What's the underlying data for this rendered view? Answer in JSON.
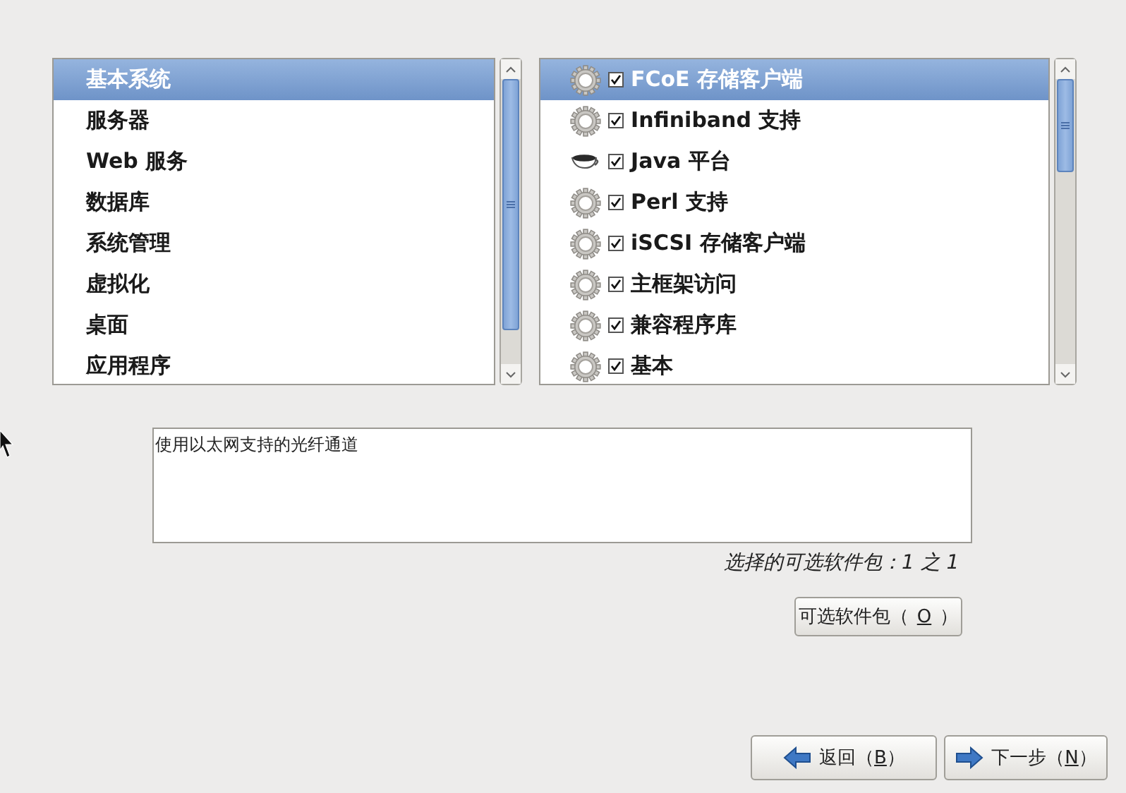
{
  "groups": {
    "items": [
      {
        "label": "基本系统",
        "selected": true
      },
      {
        "label": "服务器",
        "selected": false
      },
      {
        "label": "Web 服务",
        "selected": false
      },
      {
        "label": "数据库",
        "selected": false
      },
      {
        "label": "系统管理",
        "selected": false
      },
      {
        "label": "虚拟化",
        "selected": false
      },
      {
        "label": "桌面",
        "selected": false
      },
      {
        "label": "应用程序",
        "selected": false
      }
    ]
  },
  "packages": {
    "items": [
      {
        "label": "FCoE 存储客户端",
        "kind": "gear",
        "checked": true,
        "selected": true
      },
      {
        "label": "Infiniband 支持",
        "kind": "gear",
        "checked": true,
        "selected": false
      },
      {
        "label": "Java 平台",
        "kind": "cup",
        "checked": true,
        "selected": false
      },
      {
        "label": "Perl 支持",
        "kind": "gear",
        "checked": true,
        "selected": false
      },
      {
        "label": "iSCSI 存储客户端",
        "kind": "gear",
        "checked": true,
        "selected": false
      },
      {
        "label": "主框架访问",
        "kind": "gear",
        "checked": true,
        "selected": false
      },
      {
        "label": "兼容程序库",
        "kind": "gear",
        "checked": true,
        "selected": false
      },
      {
        "label": "基本",
        "kind": "gear",
        "checked": true,
        "selected": false
      }
    ]
  },
  "description": "使用以太网支持的光纤通道",
  "selected_count": "选择的可选软件包：1 之 1",
  "optional_button": {
    "before": "可选软件包（",
    "mnemonic": "O",
    "after": "）"
  },
  "nav_buttons": [
    {
      "kind": "back",
      "before": "返回（",
      "mnemonic": "B",
      "after": "）"
    },
    {
      "kind": "next",
      "before": "下一步（",
      "mnemonic": "N",
      "after": "）"
    }
  ]
}
